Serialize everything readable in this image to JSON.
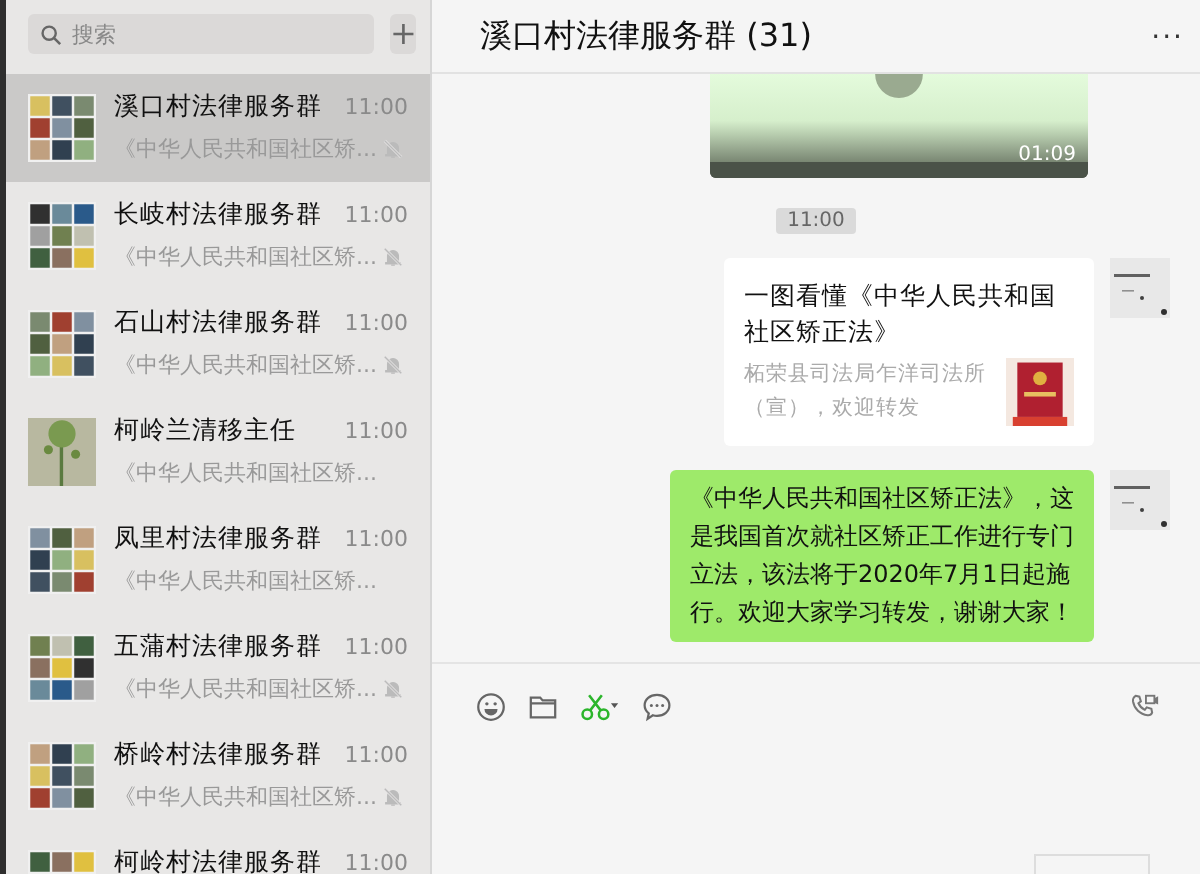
{
  "sidebar": {
    "search": {
      "placeholder": "搜索"
    },
    "add_button": "+",
    "chats": [
      {
        "name": "溪口村法律服务群",
        "preview": "《中华人民共和国社区矫...",
        "time": "11:00",
        "muted": true,
        "selected": true
      },
      {
        "name": "长岐村法律服务群",
        "preview": "《中华人民共和国社区矫...",
        "time": "11:00",
        "muted": true,
        "selected": false
      },
      {
        "name": "石山村法律服务群",
        "preview": "《中华人民共和国社区矫...",
        "time": "11:00",
        "muted": true,
        "selected": false
      },
      {
        "name": "柯岭兰清移主任",
        "preview": "《中华人民共和国社区矫...",
        "time": "11:00",
        "muted": false,
        "selected": false
      },
      {
        "name": "凤里村法律服务群",
        "preview": "《中华人民共和国社区矫...",
        "time": "11:00",
        "muted": false,
        "selected": false
      },
      {
        "name": "五蒲村法律服务群",
        "preview": "《中华人民共和国社区矫...",
        "time": "11:00",
        "muted": true,
        "selected": false
      },
      {
        "name": "桥岭村法律服务群",
        "preview": "《中华人民共和国社区矫...",
        "time": "11:00",
        "muted": true,
        "selected": false
      },
      {
        "name": "柯岭村法律服务群",
        "time": "11:00",
        "muted": false,
        "selected": false
      }
    ]
  },
  "chat": {
    "title": "溪口村法律服务群 (31)",
    "more": "...",
    "messages": [
      {
        "kind": "video",
        "duration": "01:09"
      },
      {
        "kind": "time",
        "text": "11:00"
      },
      {
        "kind": "link",
        "title": "一图看懂《中华人民共和国社区矫正法》",
        "source": "柘荣县司法局乍洋司法所（宣），欢迎转发"
      },
      {
        "kind": "text",
        "text": "《中华人民共和国社区矫正法》，这是我国首次就社区矫正工作进行专门立法，该法将于2020年7月1日起施行。欢迎大家学习转发，谢谢大家！"
      }
    ]
  }
}
